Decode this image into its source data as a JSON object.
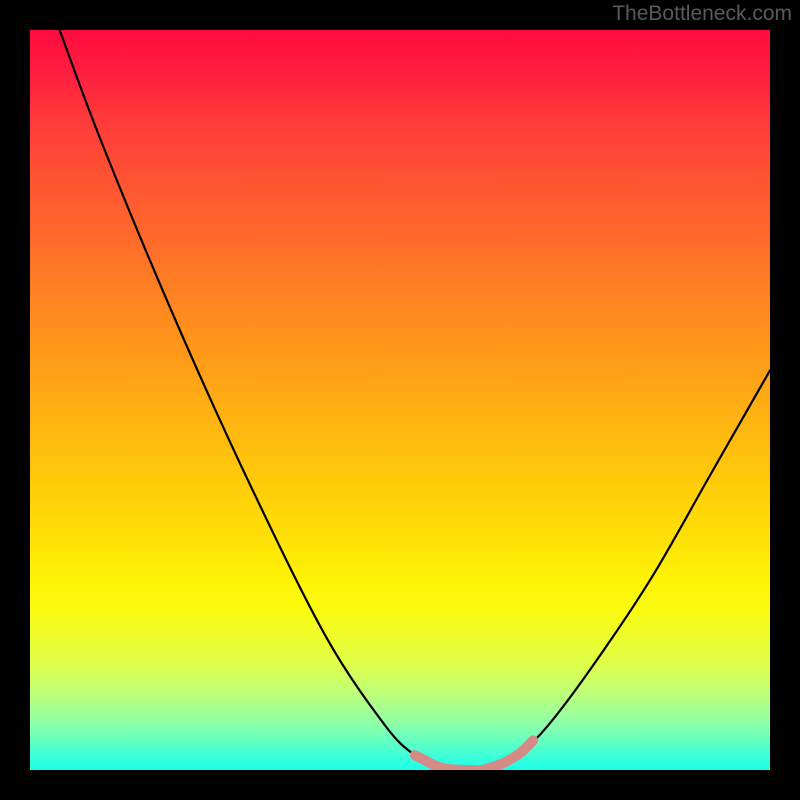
{
  "watermark": "TheBottleneck.com",
  "chart_data": {
    "type": "line",
    "title": "",
    "xlabel": "",
    "ylabel": "",
    "xlim": [
      0,
      100
    ],
    "ylim": [
      0,
      100
    ],
    "series": [
      {
        "name": "bottleneck-curve",
        "x": [
          4,
          10,
          20,
          30,
          40,
          48,
          52,
          55,
          57,
          59,
          61,
          63,
          66,
          70,
          76,
          84,
          92,
          100
        ],
        "values": [
          100,
          84,
          60,
          38,
          18,
          6,
          2,
          0.5,
          0,
          0,
          0,
          0.5,
          2,
          6,
          14,
          26,
          40,
          54
        ]
      }
    ],
    "annotations": {
      "optimal_region_x": [
        55,
        65
      ],
      "optimal_region_color": "#d58a86"
    },
    "background_gradient": {
      "top": "#ff0b41",
      "middle": "#ffde07",
      "bottom": "#1affea"
    }
  }
}
